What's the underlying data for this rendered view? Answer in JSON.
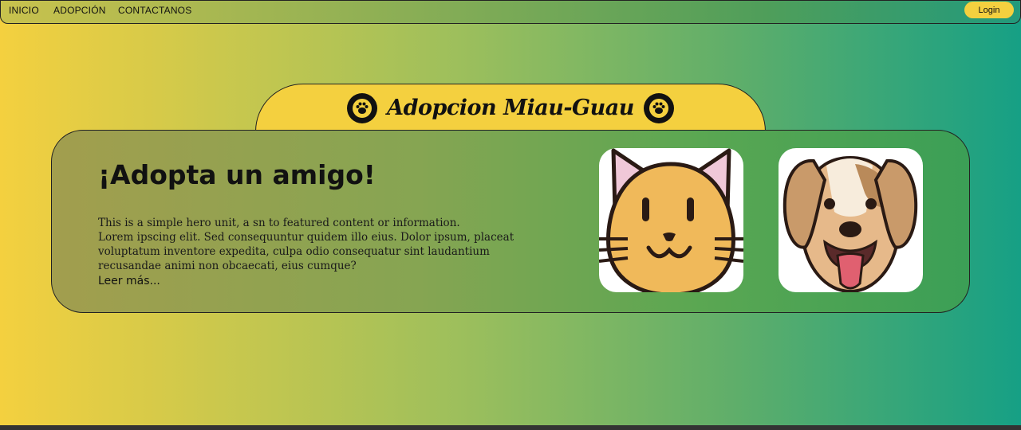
{
  "nav": {
    "links": [
      "INICIO",
      "ADOPCIÓN",
      "CONTACTANOS"
    ],
    "login_label": "Login"
  },
  "brand": {
    "title": "Adopcion Miau-Guau",
    "icon": "paw-icon"
  },
  "hero": {
    "heading": "¡Adopta un amigo!",
    "lines": [
      "This is a simple hero unit, a sn to featured content or information.",
      "Lorem ipscing elit. Sed consequuntur quidem illo eius. Dolor ipsum, placeat voluptatum inventore expedita, culpa odio consequatur sint laudantium recusandae animi non obcaecati, eius cumque?"
    ],
    "read_more": "Leer más...",
    "images": [
      "cat-face-illustration",
      "dog-face-illustration"
    ]
  },
  "colors": {
    "accent_yellow": "#f4d03f",
    "gradient_start": "#f4d03f",
    "gradient_end": "#16a085"
  }
}
